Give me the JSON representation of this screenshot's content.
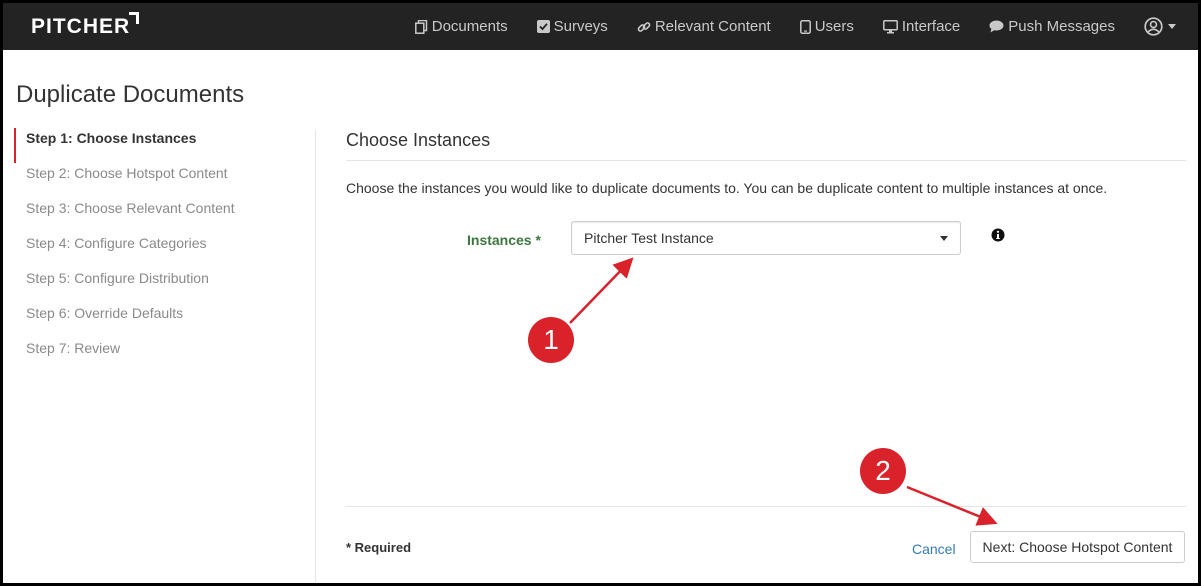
{
  "app": {
    "logo": "PITCHER"
  },
  "nav": {
    "items": [
      {
        "label": "Documents",
        "icon": "documents-icon"
      },
      {
        "label": "Surveys",
        "icon": "checkbox-icon"
      },
      {
        "label": "Relevant Content",
        "icon": "link-icon"
      },
      {
        "label": "Users",
        "icon": "tablet-icon"
      },
      {
        "label": "Interface",
        "icon": "monitor-icon"
      },
      {
        "label": "Push Messages",
        "icon": "chat-bubble-icon"
      }
    ],
    "user_icon": "user-circle-icon"
  },
  "page": {
    "title": "Duplicate Documents"
  },
  "steps": [
    {
      "label": "Step 1: Choose Instances",
      "active": true
    },
    {
      "label": "Step 2: Choose Hotspot Content",
      "active": false
    },
    {
      "label": "Step 3: Choose Relevant Content",
      "active": false
    },
    {
      "label": "Step 4: Configure Categories",
      "active": false
    },
    {
      "label": "Step 5: Configure Distribution",
      "active": false
    },
    {
      "label": "Step 6: Override Defaults",
      "active": false
    },
    {
      "label": "Step 7: Review",
      "active": false
    }
  ],
  "content": {
    "section_title": "Choose Instances",
    "description": "Choose the instances you would like to duplicate documents to. You can be duplicate content to multiple instances at once.",
    "field": {
      "label": "Instances *",
      "value": "Pitcher Test Instance"
    },
    "info_icon": "info-circle-icon"
  },
  "footer": {
    "required": "* Required",
    "cancel": "Cancel",
    "next": "Next: Choose Hotspot Content"
  },
  "annotations": [
    {
      "label": "1"
    },
    {
      "label": "2"
    }
  ],
  "colors": {
    "accent": "#d9222a",
    "navbar": "#232323",
    "link": "#337ab7",
    "label_green": "#3c763d"
  }
}
